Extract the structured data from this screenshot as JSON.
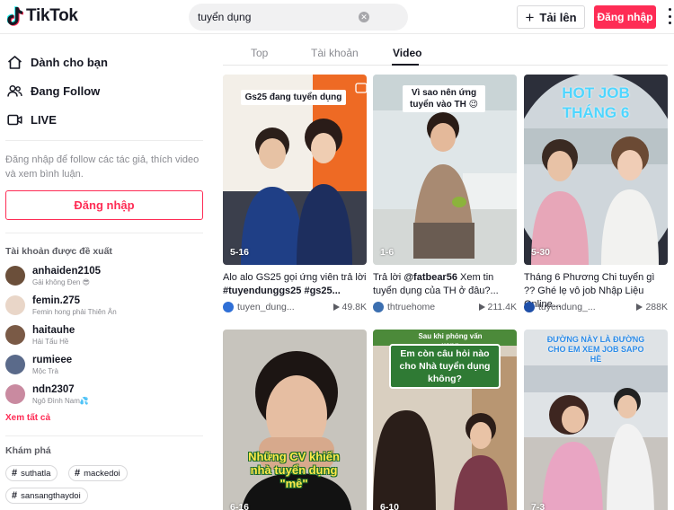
{
  "header": {
    "logo_text": "TikTok",
    "search_value": "tuyển dụng",
    "upload_label": "Tải lên",
    "login_label": "Đăng nhập"
  },
  "sidebar": {
    "nav": [
      {
        "label": "Dành cho bạn",
        "icon": "home-icon"
      },
      {
        "label": "Đang Follow",
        "icon": "following-icon"
      },
      {
        "label": "LIVE",
        "icon": "live-icon"
      }
    ],
    "hint": "Đăng nhập để follow các tác giả, thích video và xem bình luận.",
    "login_label": "Đăng nhập",
    "suggested_title": "Tài khoản được đề xuất",
    "accounts": [
      {
        "name": "anhaiden2105",
        "sub": "Gải không Đen 😎",
        "color": "#6b4f3a"
      },
      {
        "name": "femin.275",
        "sub": "Femin hong phải Thiên Ân",
        "color": "#e9d6c8"
      },
      {
        "name": "haitauhe",
        "sub": "Hải Tẩu Hề",
        "color": "#7a5a46"
      },
      {
        "name": "rumieee",
        "sub": "Mộc Trà",
        "color": "#5a6a8a"
      },
      {
        "name": "ndn2307",
        "sub": "Ngô Đình Nam💦",
        "color": "#c98aa0"
      }
    ],
    "see_all": "Xem tất cả",
    "discover_title": "Khám phá",
    "tags": [
      "suthatla",
      "mackedoi",
      "sansangthaydoi"
    ]
  },
  "tabs": [
    "Top",
    "Tài khoản",
    "Video"
  ],
  "active_tab": "Video",
  "videos": [
    {
      "date": "5-16",
      "overlay": "Gs25 đang tuyển dụng",
      "caption_plain": "Alo alo GS25 gọi ứng viên trả lời ",
      "caption_bold": "#tuyendunggs25 #gs25...",
      "author": "tuyen_dung...",
      "views": "49.8K"
    },
    {
      "date": "1-6",
      "overlay": "Vì sao nên ứng tuyển vào TH 😉",
      "caption_plain": "Trả lời ",
      "caption_bold": "@fatbear56",
      "caption_tail": " Xem tin tuyển dụng của TH ở đâu?...",
      "author": "thtruehome",
      "views": "211.4K"
    },
    {
      "date": "5-30",
      "overlay": "HOT JOB THÁNG 6",
      "caption_plain": "Tháng 6 Phương Chi tuyển gì ?? Ghé lẹ vô job Nhập Liệu Online...",
      "author": "tuyendung_...",
      "views": "288K"
    },
    {
      "date": "6-16",
      "overlay": "Những CV khiến nhà tuyển dụng \"mê\""
    },
    {
      "date": "6-10",
      "overlay": "Em còn câu hỏi nào cho Nhà tuyển dụng không?",
      "overlay_top": "Sau khi phỏng vấn xong"
    },
    {
      "date": "7-3",
      "overlay": "ĐƯỜNG NÀY LÀ ĐƯỜNG CHO EM XEM JOB SAPO HỀ"
    }
  ]
}
